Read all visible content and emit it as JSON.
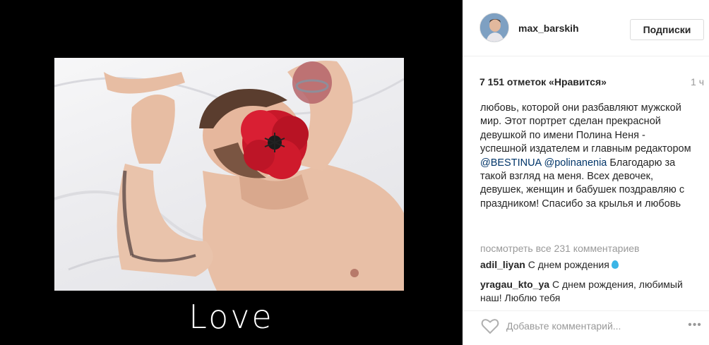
{
  "post": {
    "image_caption_word": "Love",
    "image_alt": "Man lying on white sheets with a red poppy flower over his face"
  },
  "profile": {
    "username": "max_barskih",
    "follow_label": "Подписки"
  },
  "meta": {
    "likes": "7 151 отметок «Нравится»",
    "time": "1 ч"
  },
  "caption": {
    "line_intro": "любовь, которой они разбавляют мужской мир. Этот портрет сделан прекрасной девушкой по имени Полина Неня - успешной издателем и главным редактором ",
    "mention1": "@BESTINUA",
    "mention2": "@polinanenia",
    "line_outro": " Благодарю за такой взгляд на меня. Всех девочек, девушек, женщин и бабушек поздравляю с праздником! Спасибо за крылья и любовь"
  },
  "comments": {
    "view_all": "посмотреть все 231 комментариев",
    "items": [
      {
        "user": "adil_liyan",
        "text": "С днем рождения"
      },
      {
        "user": "yragau_kto_ya",
        "text": "С днем рождения, любимый наш! Люблю тебя"
      }
    ]
  },
  "add_comment": {
    "placeholder": "Добавьте комментарий..."
  },
  "icons": {
    "heart": "heart-outline-icon",
    "more": "more-options-icon",
    "drop": "water-drop-emoji"
  }
}
